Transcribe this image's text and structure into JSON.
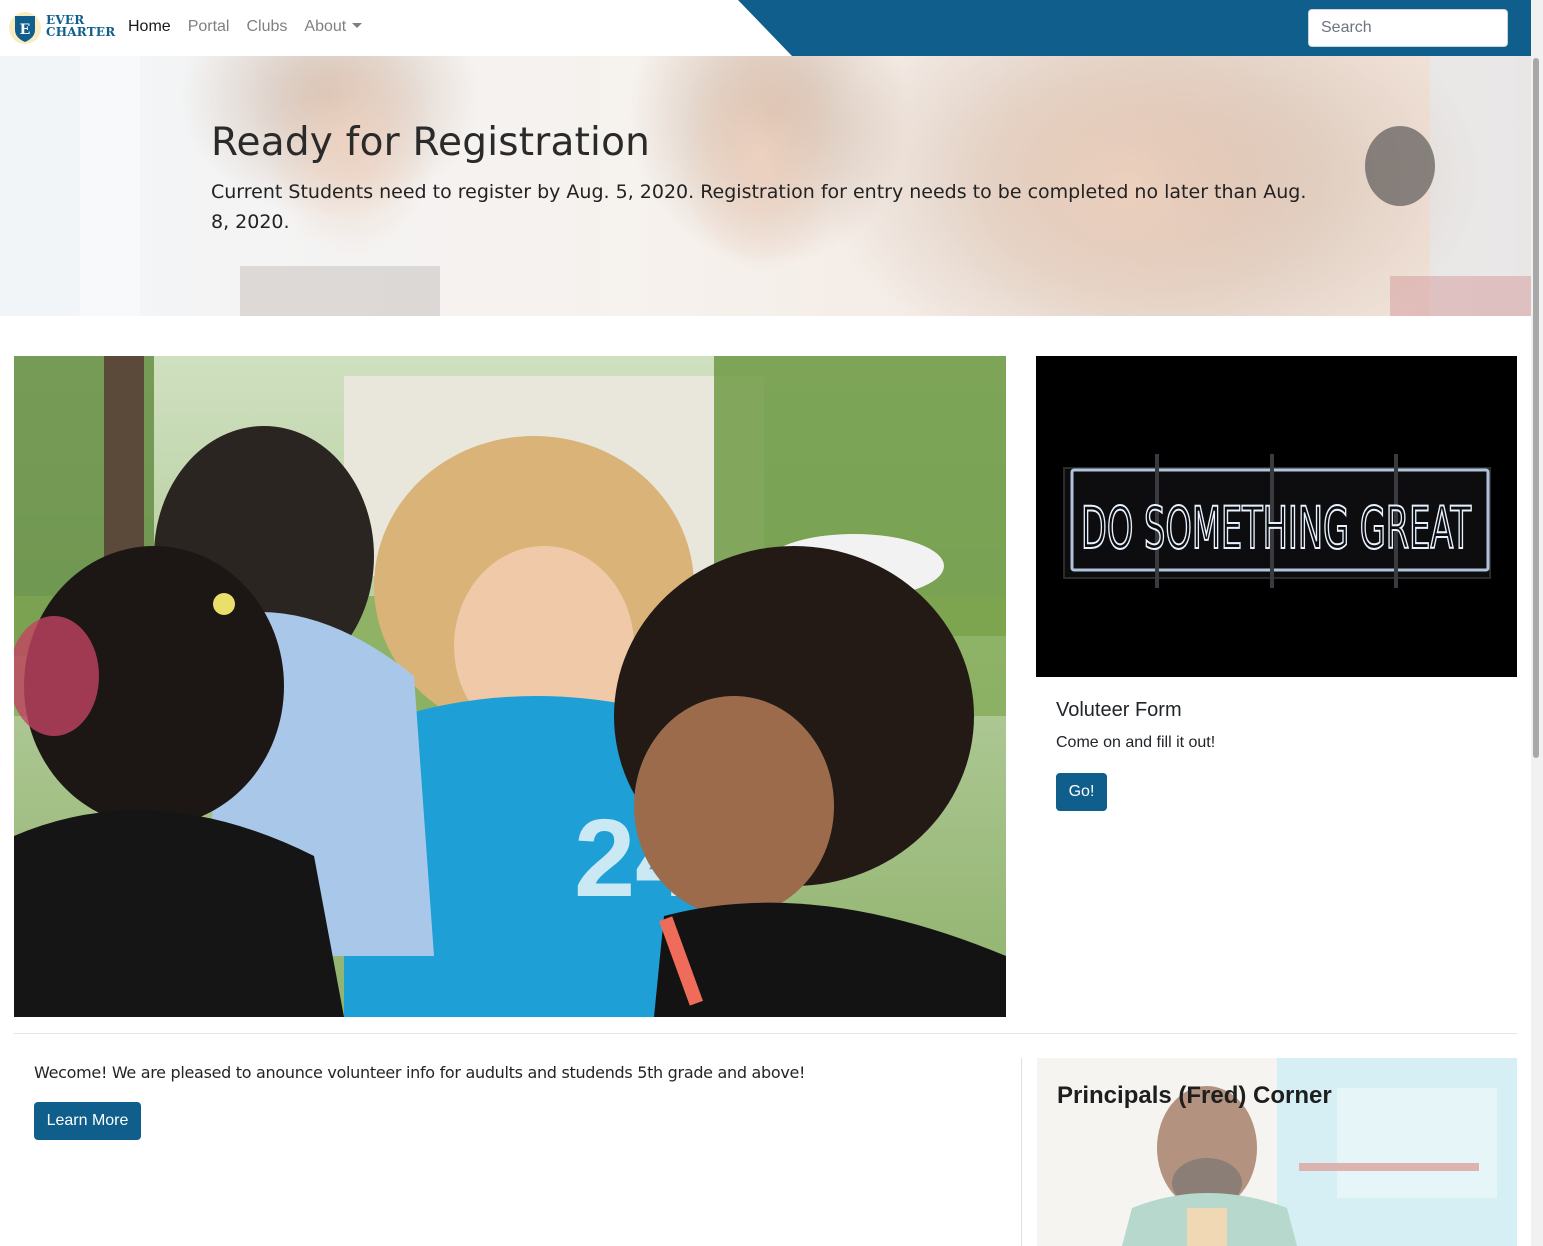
{
  "brand": {
    "line1": "EVER",
    "line2": "CHARTER",
    "shield_letter": "E",
    "color": "#0f5e8c"
  },
  "nav": {
    "items": [
      {
        "label": "Home",
        "active": true
      },
      {
        "label": "Portal",
        "active": false
      },
      {
        "label": "Clubs",
        "active": false
      },
      {
        "label": "About",
        "active": false,
        "dropdown": true
      }
    ],
    "search_placeholder": "Search"
  },
  "hero": {
    "title": "Ready for Registration",
    "text": "Current Students need to register by Aug. 5, 2020. Registration for entry needs to be completed no later than Aug. 8, 2020."
  },
  "volunteer_card": {
    "image_text": "DO SOMETHING GREAT",
    "title": "Voluteer Form",
    "text": "Come on and fill it out!",
    "button": "Go!"
  },
  "welcome": {
    "text": "Wecome! We are pleased to anounce volunteer info for audults and studends 5th grade and above!",
    "button": "Learn More"
  },
  "principal": {
    "title": "Principals (Fred) Corner"
  },
  "colors": {
    "primary": "#0f5e8c",
    "navbar_accent": "#0f5e8c"
  }
}
